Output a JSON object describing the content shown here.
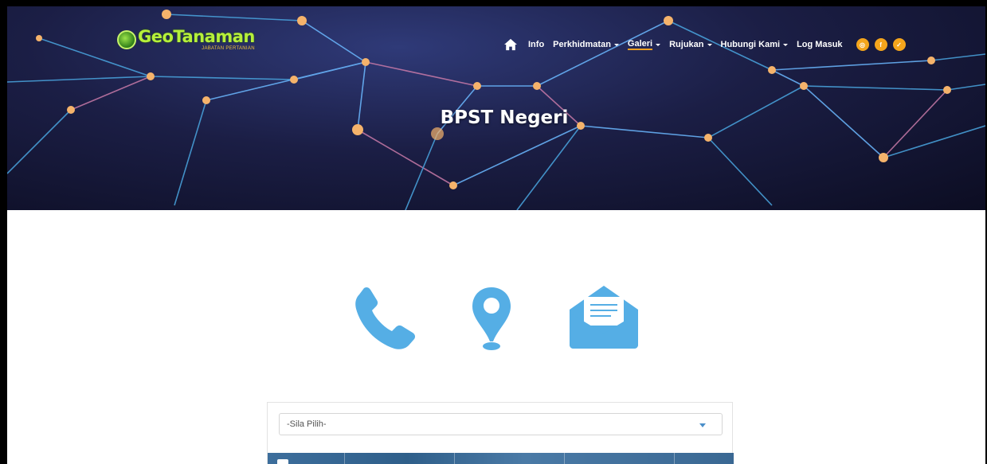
{
  "header": {
    "logo": {
      "title": "GeoTanaman",
      "subtitle": "JABATAN PERTANIAN"
    },
    "nav": {
      "home_icon": "home-icon",
      "items": [
        {
          "label": "Info",
          "dropdown": false
        },
        {
          "label": "Perkhidmatan",
          "dropdown": true
        },
        {
          "label": "Galeri",
          "dropdown": true
        },
        {
          "label": "Rujukan",
          "dropdown": true
        },
        {
          "label": "Hubungi Kami",
          "dropdown": true
        },
        {
          "label": "Log Masuk",
          "dropdown": false
        }
      ],
      "social": [
        "instagram-icon",
        "facebook-icon",
        "twitter-icon"
      ]
    },
    "page_title": "BPST Negeri"
  },
  "contact_icons": [
    "phone-icon",
    "location-pin-icon",
    "email-icon"
  ],
  "form": {
    "select_value": "-Sila Pilih-"
  },
  "colors": {
    "accent": "#f4a51c",
    "icon_blue": "#55aee5",
    "logo_green": "#b6f03a"
  }
}
